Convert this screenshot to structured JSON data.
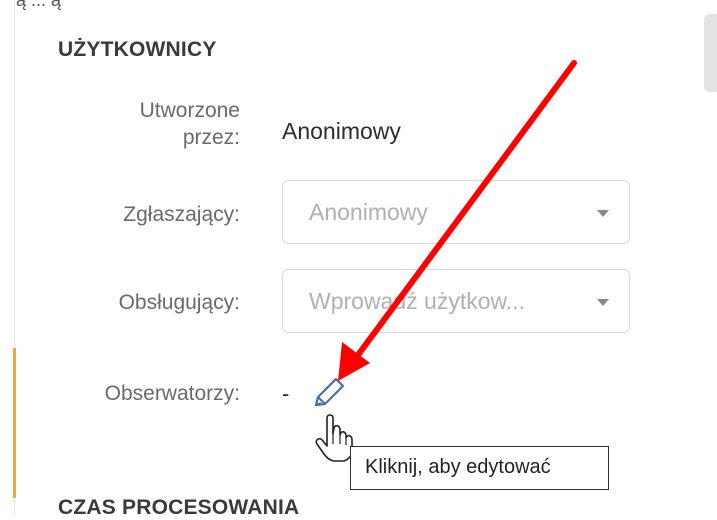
{
  "top_fragment": "ą ... ą",
  "users_section": {
    "title": "UŻYTKOWNICY",
    "created_by_label_line1": "Utworzone",
    "created_by_label_line2": "przez:",
    "created_by_value": "Anonimowy",
    "reporter_label": "Zgłaszający:",
    "reporter_value": "Anonimowy",
    "assignee_label": "Obsługujący:",
    "assignee_placeholder": "Wprowadź użytkow...",
    "watchers_label": "Obserwatorzy:",
    "watchers_value": "-"
  },
  "tooltip": {
    "text": "Kliknij, aby edytować"
  },
  "processing_section": {
    "title": "CZAS PROCESOWANIA"
  },
  "icons": {
    "edit": "pencil-icon",
    "cursor": "hand-pointer-icon",
    "select_caret": "caret-down-icon"
  },
  "colors": {
    "annotation_arrow": "#ff0000",
    "accent": "#f5a742",
    "pencil": "#4a6fa5"
  }
}
